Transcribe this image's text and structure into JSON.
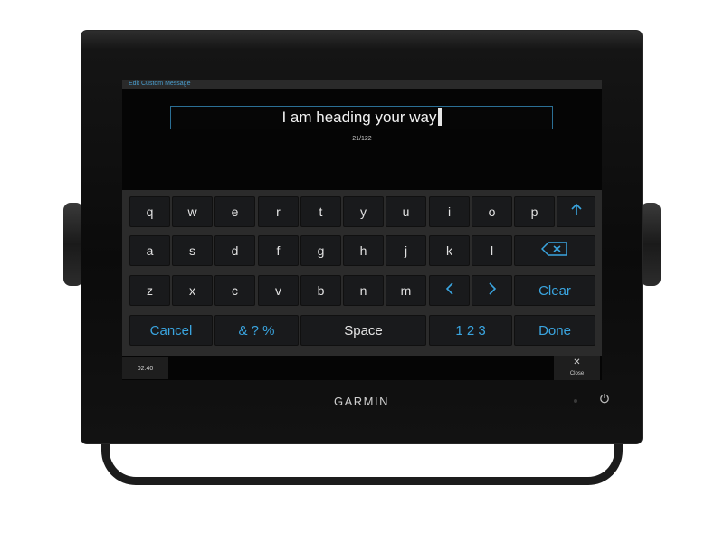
{
  "screen": {
    "title": "Edit Custom Message",
    "message": "I am heading your way",
    "char_count": "21/122",
    "time": "02:40",
    "close_label": "Close",
    "close_icon": "close-icon"
  },
  "keyboard": {
    "row1": [
      "q",
      "w",
      "e",
      "r",
      "t",
      "y",
      "u",
      "i",
      "o",
      "p"
    ],
    "row2": [
      "a",
      "s",
      "d",
      "f",
      "g",
      "h",
      "j",
      "k",
      "l"
    ],
    "row3": [
      "z",
      "x",
      "c",
      "v",
      "b",
      "n",
      "m"
    ],
    "shift_icon": "arrow-up-icon",
    "backspace_icon": "backspace-icon",
    "left_icon": "chevron-left-icon",
    "right_icon": "chevron-right-icon",
    "clear_label": "Clear",
    "cancel_label": "Cancel",
    "symbols_label": "& ? %",
    "space_label": "Space",
    "numbers_label": "1 2 3",
    "done_label": "Done"
  },
  "device": {
    "brand": "GARMIN",
    "power_icon": "power-icon"
  },
  "colors": {
    "accent": "#3aa5e0",
    "key_background": "#191a1c",
    "keyboard_background": "#2b2b2b",
    "screen_background": "#050505"
  }
}
